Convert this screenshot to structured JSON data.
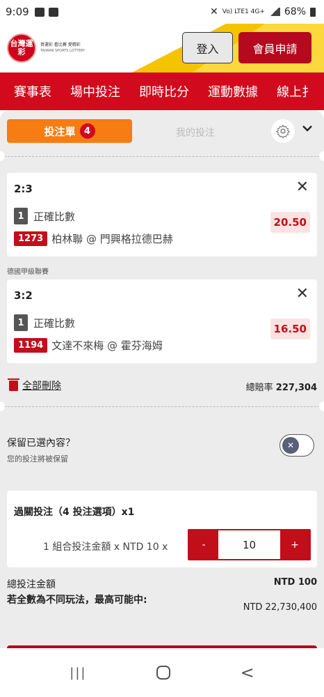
{
  "status_bar": {
    "time": "9:09",
    "network": "Vo) LTE1 4G+",
    "battery": "68%"
  },
  "header": {
    "logo_text": "台灣運彩",
    "logo_caption_1": "買運彩 看比賽 愛精彩",
    "logo_caption_2": "TAIWAN SPORTS LOTTERY",
    "login_label": "登入",
    "join_label": "會員申請"
  },
  "nav": {
    "items": [
      "賽事表",
      "場中投注",
      "即時比分",
      "運動數據",
      "線上扌"
    ]
  },
  "slip": {
    "tab_active": "投注單",
    "tab_count": "4",
    "tab_other": "我的投注",
    "bets": [
      {
        "score": "2:3",
        "num": "1",
        "type": "正確比數",
        "match_id": "1273",
        "match": "柏林聯 @ 門興格拉德巴赫",
        "odds": "20.50"
      },
      {
        "score": "3:2",
        "num": "1",
        "type": "正確比數",
        "match_id": "1194",
        "match": "文達不來梅 @ 霍芬海姆",
        "odds": "16.50"
      }
    ],
    "league": "德國甲級聯賽",
    "delete_all": "全部刪除",
    "total_odds_label": "總賠率",
    "total_odds_value": "227,304",
    "keep_title": "保留已選內容？",
    "keep_sub": "您的投注將被保留",
    "parlay_title": "過關投注（4 投注選項）x1",
    "parlay_label": "1 組合投注金額 x NTD 10 x",
    "stepper_minus": "-",
    "stepper_value": "10",
    "stepper_plus": "+",
    "total_stake_label": "總投注金額",
    "total_stake_value": "NTD 100",
    "max_win_label": "若全數為不同玩法，最高可能中:",
    "max_win_value": "NTD 22,730,400"
  },
  "sysnav": {
    "menu": "|||",
    "home": "",
    "back": "<"
  }
}
